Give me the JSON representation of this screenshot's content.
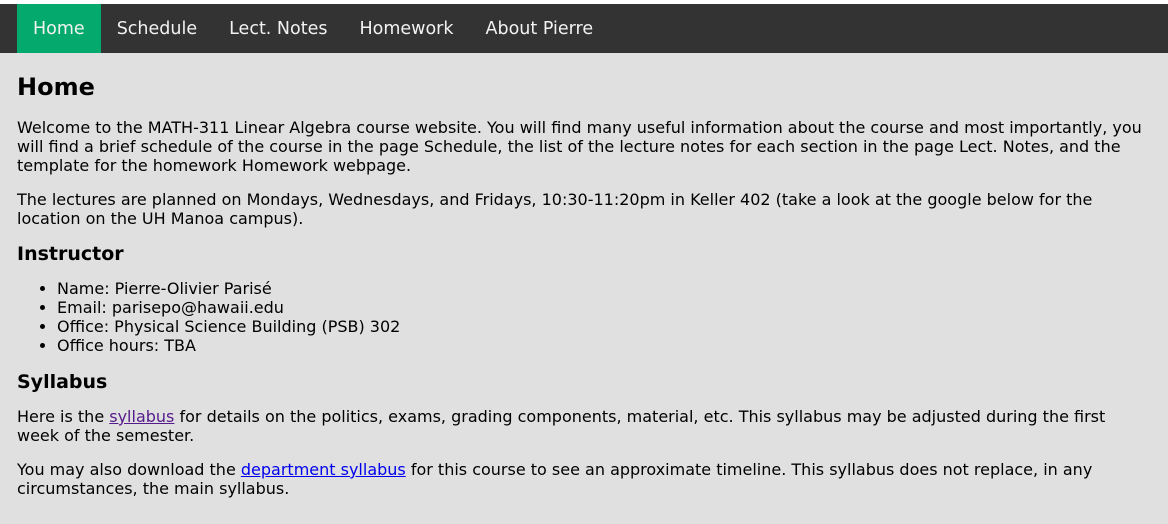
{
  "nav": {
    "items": [
      "Home",
      "Schedule",
      "Lect. Notes",
      "Homework",
      "About Pierre"
    ],
    "active_index": 0,
    "active_color": "#04aa6d",
    "bar_color": "#333333"
  },
  "page": {
    "title": "Home",
    "intro": "Welcome to the MATH-311 Linear Algebra course website. You will find many useful information about the course and most importantly, you will find a brief schedule of the course in the page Schedule, the list of the lecture notes for each section in the page Lect. Notes, and the template for the homework Homework webpage.",
    "lectures": "The lectures are planned on Mondays, Wednesdays, and Fridays, 10:30-11:20pm in Keller 402 (take a look at the google below for the location on the UH Manoa campus)."
  },
  "instructor": {
    "heading": "Instructor",
    "items": [
      "Name: Pierre-Olivier Parisé",
      "Email: parisepo@hawaii.edu",
      "Office: Physical Science Building (PSB) 302",
      "Office hours: TBA"
    ]
  },
  "syllabus": {
    "heading": "Syllabus",
    "p1_before": "Here is the ",
    "p1_link": "syllabus",
    "p1_after": " for details on the politics, exams, grading components, material, etc. This syllabus may be adjusted during the first week of the semester.",
    "p2_before": "You may also download the ",
    "p2_link": "department syllabus",
    "p2_after": " for this course to see an approximate timeline. This syllabus does not replace, in any circumstances, the main syllabus."
  }
}
